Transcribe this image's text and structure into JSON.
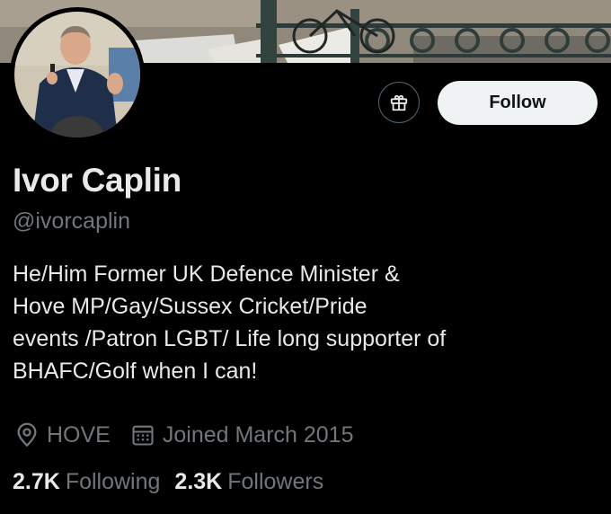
{
  "profile": {
    "display_name": "Ivor Caplin",
    "handle": "@ivorcaplin",
    "bio_lines": [
      "He/Him Former UK Defence Minister &",
      "Hove MP/Gay/Sussex Cricket/Pride",
      "events /Patron LGBT/ Life long supporter of",
      "BHAFC/Golf when I can!"
    ],
    "location": "HOVE",
    "joined": "Joined March 2015"
  },
  "actions": {
    "gift_icon": "gift-icon",
    "follow_label": "Follow"
  },
  "stats": {
    "following_count": "2.7K",
    "following_label": "Following",
    "followers_count": "2.3K",
    "followers_label": "Followers"
  },
  "icons": {
    "location": "location-pin-icon",
    "calendar": "calendar-icon"
  },
  "colors": {
    "background": "#000000",
    "text_primary": "#e7e9ea",
    "text_secondary": "#71767b",
    "follow_button_bg": "#eff3f4",
    "follow_button_text": "#0f1419",
    "border": "#536471"
  }
}
